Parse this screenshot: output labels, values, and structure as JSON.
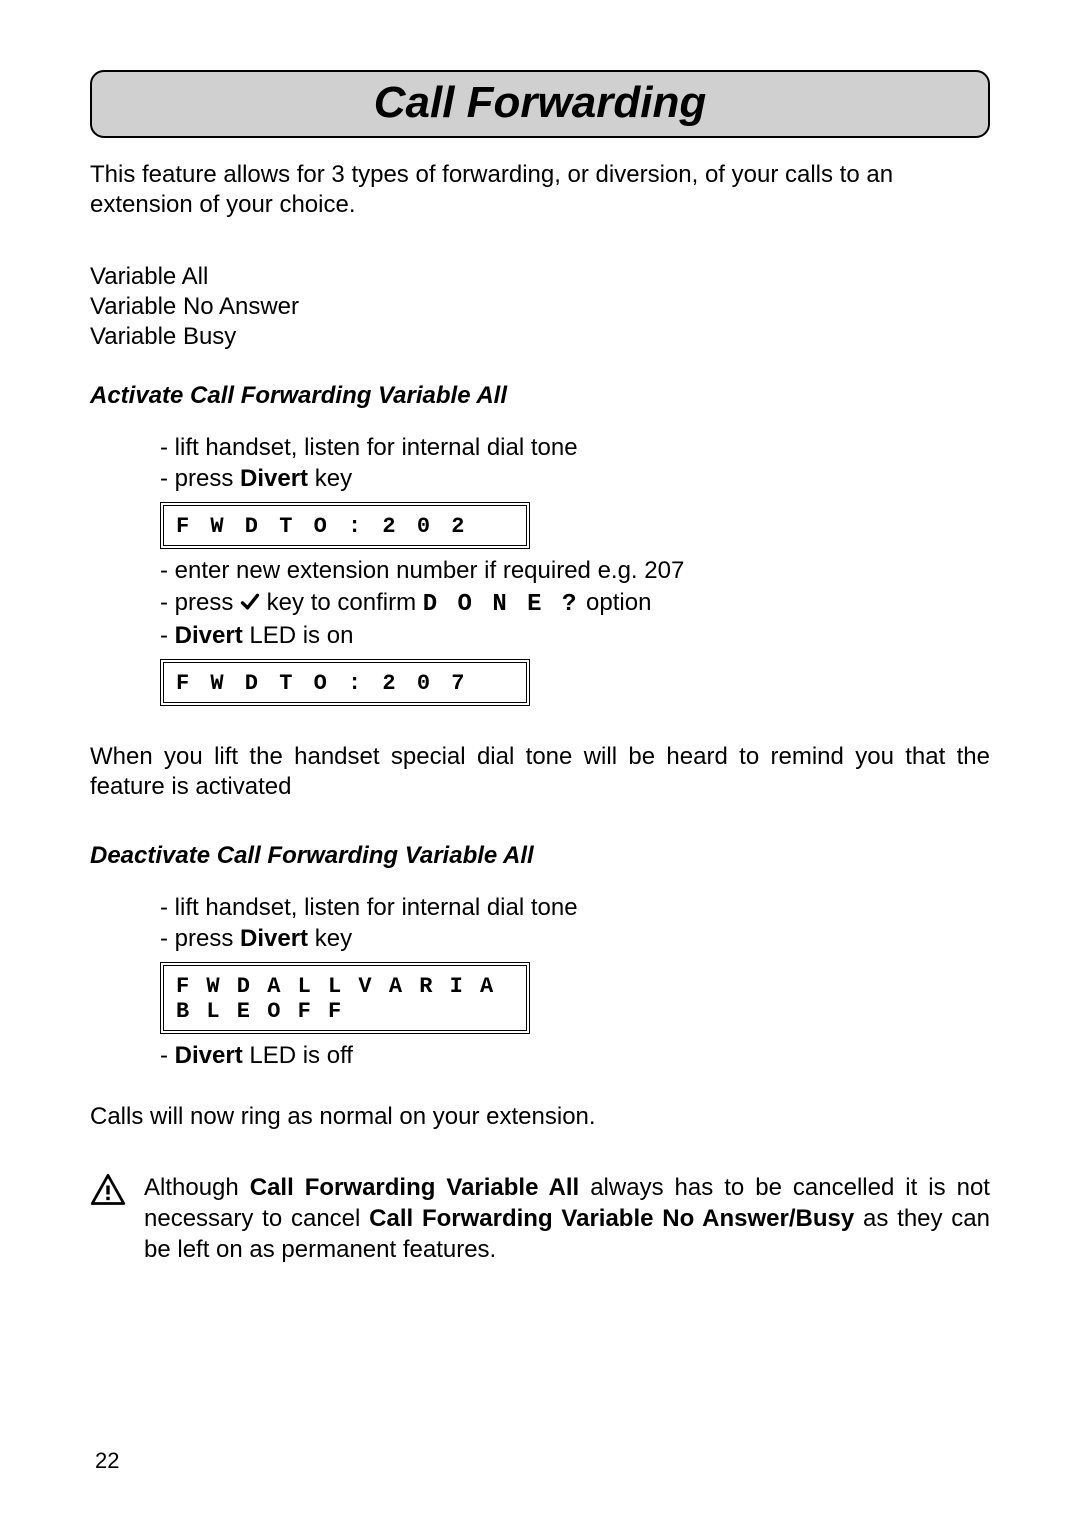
{
  "title": "Call Forwarding",
  "intro": "This feature allows for 3 types of forwarding, or diversion, of your calls to an extension of your choice.",
  "types": [
    "Variable All",
    "Variable No Answer",
    "Variable Busy"
  ],
  "section_activate": {
    "heading": "Activate Call Forwarding Variable All",
    "step1": "- lift handset, listen for internal dial tone",
    "step2_prefix": "- press ",
    "step2_bold": "Divert",
    "step2_suffix": " key",
    "display1": "F W D  T O : 2 0 2",
    "step3": "- enter new extension number if required e.g. 207",
    "step4_prefix": "- press  ",
    "step4_mid": "  key to confirm  ",
    "step4_segment": "D O N E ?",
    "step4_suffix": " option",
    "step5_prefix": "- ",
    "step5_bold": "Divert",
    "step5_suffix": " LED is on",
    "display2": "F W D  T O : 2 0 7",
    "note_after": "When you lift the handset special dial tone will be heard to remind you that the feature is activated"
  },
  "section_deactivate": {
    "heading": "Deactivate Call Forwarding Variable All",
    "step1": "- lift handset, listen for internal dial tone",
    "step2_prefix": "- press ",
    "step2_bold": "Divert",
    "step2_suffix": " key",
    "display": "F W D  A L L  V A R I A B L E  O F F",
    "step3_prefix": "- ",
    "step3_bold": "Divert",
    "step3_suffix": " LED is off",
    "note_after": "Calls will now ring as normal on your extension."
  },
  "warning": {
    "t1": "Although ",
    "b1": "Call Forwarding Variable All",
    "t2": " always has to be cancelled it is not necessary to cancel ",
    "b2": "Call Forwarding Variable No Answer/Busy",
    "t3": " as they can be left on as permanent features."
  },
  "page_number": "22"
}
